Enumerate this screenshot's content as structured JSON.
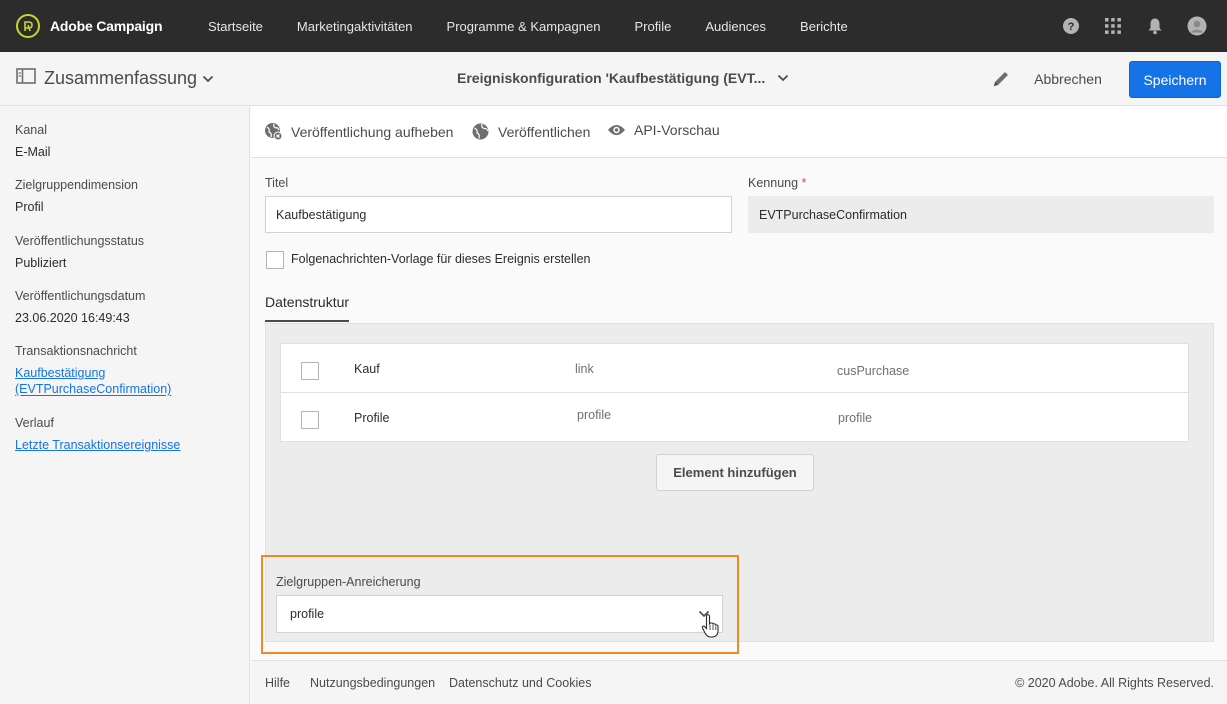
{
  "header": {
    "app_name": "Adobe Campaign",
    "nav": [
      "Startseite",
      "Marketingaktivitäten",
      "Programme & Kampagnen",
      "Profile",
      "Audiences",
      "Berichte"
    ]
  },
  "actionbar": {
    "summary_label": "Zusammenfassung",
    "page_title": "Ereigniskonfiguration 'Kaufbestätigung (EVT...",
    "cancel_label": "Abbrechen",
    "save_label": "Speichern"
  },
  "sidebar": {
    "channel_label": "Kanal",
    "channel_value": "E-Mail",
    "dimension_label": "Zielgruppendimension",
    "dimension_value": "Profil",
    "pubstatus_label": "Veröffentlichungsstatus",
    "pubstatus_value": "Publiziert",
    "pubdate_label": "Veröffentlichungsdatum",
    "pubdate_value": "23.06.2020 16:49:43",
    "txmsg_label": "Transaktionsnachricht",
    "txmsg_link_line1": "Kaufbestätigung",
    "txmsg_link_line2": "(EVTPurchaseConfirmation)",
    "history_label": "Verlauf",
    "history_link": "Letzte Transaktionsereignisse"
  },
  "toolbar": {
    "unpublish": "Veröffentlichung aufheben",
    "publish": "Veröffentlichen",
    "api_preview": "API-Vorschau"
  },
  "form": {
    "title_label": "Titel",
    "title_value": "Kaufbestätigung",
    "id_label": "Kennung",
    "id_required": "*",
    "id_value": "EVTPurchaseConfirmation",
    "followup_label": "Folgenachrichten-Vorlage für dieses Ereignis erstellen",
    "tab_label": "Datenstruktur"
  },
  "data_structure": {
    "rows": [
      {
        "name": "Kauf",
        "type": "link",
        "id": "cusPurchase"
      },
      {
        "name": "Profile",
        "type": "profile",
        "id": "profile"
      }
    ],
    "add_button": "Element hinzufügen"
  },
  "enrichment": {
    "label": "Zielgruppen-Anreicherung",
    "value": "profile",
    "highlight_color": "#f08a24"
  },
  "footer": {
    "links": [
      "Hilfe",
      "Nutzungsbedingungen",
      "Datenschutz und Cookies"
    ],
    "copyright": "© 2020 Adobe. All Rights Reserved."
  }
}
